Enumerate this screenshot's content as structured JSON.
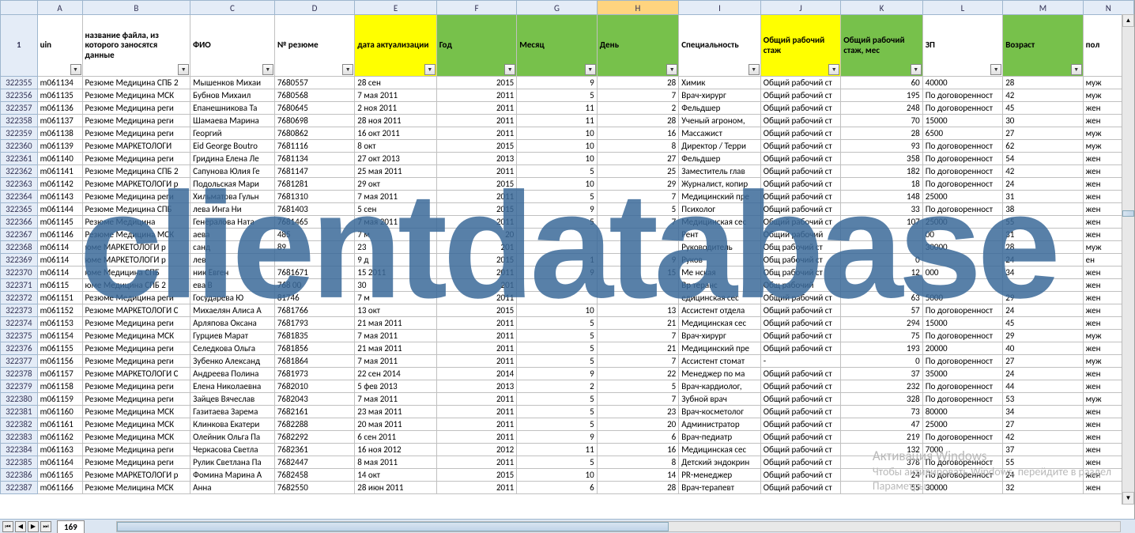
{
  "watermark": "clientdatabase",
  "activation": {
    "line1": "Активация Windows",
    "line2": "Чтобы активировать Windows, перейдите в раздел",
    "line3": "Параметры."
  },
  "sheet_tab": "169",
  "columns": [
    "",
    "A",
    "B",
    "C",
    "D",
    "E",
    "F",
    "G",
    "H",
    "I",
    "J",
    "K",
    "L",
    "M",
    "N"
  ],
  "selected_col": "H",
  "header_row_num": "1",
  "headers": {
    "A": {
      "label": "uin",
      "style": ""
    },
    "B": {
      "label": "название файла, из которого заносятся данные",
      "style": ""
    },
    "C": {
      "label": "ФИО",
      "style": ""
    },
    "D": {
      "label": "№ резюме",
      "style": ""
    },
    "E": {
      "label": "дата актуализации",
      "style": "hyellow"
    },
    "F": {
      "label": "Год",
      "style": "hgreen"
    },
    "G": {
      "label": "Месяц",
      "style": "hgreen"
    },
    "H": {
      "label": "День",
      "style": "hgreen"
    },
    "I": {
      "label": "Специальность",
      "style": ""
    },
    "J": {
      "label": "Общий рабочий стаж",
      "style": "hyellow"
    },
    "K": {
      "label": "Общий рабочий стаж, мес",
      "style": "hgreen"
    },
    "L": {
      "label": "ЗП",
      "style": ""
    },
    "M": {
      "label": "Возраст",
      "style": "hgreen"
    },
    "N": {
      "label": "пол",
      "style": ""
    }
  },
  "rows": [
    {
      "n": "322355",
      "A": "m061134",
      "B": "Резюме Медицина СПБ 2",
      "C": "Мышенков Михаи",
      "D": "7680557",
      "E": "28 сен",
      "F": "2015",
      "G": "9",
      "H": "28",
      "I": "Химик",
      "J": "Общий рабочий ст",
      "K": "60",
      "L": "40000",
      "M": "28",
      "N": "муж"
    },
    {
      "n": "322356",
      "A": "m061135",
      "B": "Резюме Медицина МСК",
      "C": "Бубнов Михаил",
      "D": "7680568",
      "E": "7 мая 2011",
      "F": "2011",
      "G": "5",
      "H": "7",
      "I": "Врач-хирург",
      "J": "Общий рабочий ст",
      "K": "195",
      "L": "По договоренност",
      "M": "42",
      "N": "муж"
    },
    {
      "n": "322357",
      "A": "m061136",
      "B": "Резюме Медицина реги",
      "C": "Епанешникова Та",
      "D": "7680645",
      "E": "2 ноя 2011",
      "F": "2011",
      "G": "11",
      "H": "2",
      "I": "Фельдшер",
      "J": "Общий рабочий ст",
      "K": "248",
      "L": "По договоренност",
      "M": "45",
      "N": "жен"
    },
    {
      "n": "322358",
      "A": "m061137",
      "B": "Резюме Медицина реги",
      "C": "Шамаева Марина",
      "D": "7680698",
      "E": "28 ноя 2011",
      "F": "2011",
      "G": "11",
      "H": "28",
      "I": "Ученый агроном,",
      "J": "Общий рабочий ст",
      "K": "70",
      "L": "15000",
      "M": "30",
      "N": "жен"
    },
    {
      "n": "322359",
      "A": "m061138",
      "B": "Резюме Медицина реги",
      "C": "Георгий",
      "D": "7680862",
      "E": "16 окт 2011",
      "F": "2011",
      "G": "10",
      "H": "16",
      "I": "Массажист",
      "J": "Общий рабочий ст",
      "K": "28",
      "L": "6500",
      "M": "27",
      "N": "муж"
    },
    {
      "n": "322360",
      "A": "m061139",
      "B": "Резюме МАРКЕТОЛОГИ",
      "C": "Eid George Boutro",
      "D": "7681116",
      "E": "8 окт",
      "F": "2015",
      "G": "10",
      "H": "8",
      "I": "Директор / Терри",
      "J": "Общий рабочий ст",
      "K": "93",
      "L": "По договоренност",
      "M": "62",
      "N": "муж"
    },
    {
      "n": "322361",
      "A": "m061140",
      "B": "Резюме Медицина реги",
      "C": "Гридина Елена Ле",
      "D": "7681134",
      "E": "27 окт 2013",
      "F": "2013",
      "G": "10",
      "H": "27",
      "I": "Фельдшер",
      "J": "Общий рабочий ст",
      "K": "358",
      "L": "По договоренност",
      "M": "54",
      "N": "жен"
    },
    {
      "n": "322362",
      "A": "m061141",
      "B": "Резюме Медицина СПБ 2",
      "C": "Сапунова Юлия Ге",
      "D": "7681147",
      "E": "25 мая 2011",
      "F": "2011",
      "G": "5",
      "H": "25",
      "I": "Заместитель глав",
      "J": "Общий рабочий ст",
      "K": "182",
      "L": "По договоренност",
      "M": "42",
      "N": "жен"
    },
    {
      "n": "322363",
      "A": "m061142",
      "B": "Резюме МАРКЕТОЛОГИ р",
      "C": "Подольская Мари",
      "D": "7681281",
      "E": "29 окт",
      "F": "2015",
      "G": "10",
      "H": "29",
      "I": "Журналист, копир",
      "J": "Общий рабочий ст",
      "K": "18",
      "L": "По договоренност",
      "M": "24",
      "N": "жен"
    },
    {
      "n": "322364",
      "A": "m061143",
      "B": "Резюме Медицина реги",
      "C": "Хильматова Гульн",
      "D": "7681310",
      "E": "7 мая 2011",
      "F": "2011",
      "G": "5",
      "H": "7",
      "I": "Медицинский пре",
      "J": "Общий рабочий ст",
      "K": "148",
      "L": "25000",
      "M": "31",
      "N": "жен"
    },
    {
      "n": "322365",
      "A": "m061144",
      "B": "Резюме Медицина СПБ",
      "C": "лева Инга Ни",
      "D": "7681403",
      "E": "5 сен",
      "F": "2015",
      "G": "9",
      "H": "5",
      "I": "Психолог",
      "J": "Общий рабочий ст",
      "K": "33",
      "L": "По договоренност",
      "M": "38",
      "N": "жен"
    },
    {
      "n": "322366",
      "A": "m061145",
      "B": "Резюме Медицина",
      "C": "Генералова Ната",
      "D": "7681465",
      "E": "7 мая 2011",
      "F": "2011",
      "G": "5",
      "H": "7",
      "I": "Медицинская сес",
      "J": "Общий рабочий ст",
      "K": "107",
      "L": "25000",
      "M": "55",
      "N": "жен"
    },
    {
      "n": "322367",
      "A": "m061146",
      "B": "Резюме Медицина МСК",
      "C": "аева",
      "D": "485",
      "E": "7 м",
      "F": "20",
      "G": "",
      "H": "",
      "I": "Рент",
      "J": "Общий рабочий",
      "K": "",
      "L": "00",
      "M": "31",
      "N": "жен"
    },
    {
      "n": "322368",
      "A": "m06114",
      "B": "юме МАРКЕТОЛОГИ р",
      "C": "санд",
      "D": "89",
      "E": "23",
      "F": "201",
      "G": "",
      "H": "",
      "I": "Руководитель",
      "J": "Общ рабочий ст",
      "K": "",
      "L": "30000",
      "M": "28",
      "N": "муж"
    },
    {
      "n": "322369",
      "A": "m06114",
      "B": "юме МАРКЕТОЛОГИ р",
      "C": "лев",
      "D": "",
      "E": "9 д",
      "F": "2015",
      "G": "1",
      "H": "9",
      "I": "Руков",
      "J": "Общ рабочий ст",
      "K": "0",
      "L": "",
      "M": "24",
      "N": "ен"
    },
    {
      "n": "322370",
      "A": "m06114",
      "B": "юме Медицина СПБ",
      "C": "ник Евген",
      "D": "7681671",
      "E": "15    2011",
      "F": "2011",
      "G": "9",
      "H": "15",
      "I": "Ме     нская",
      "J": "Общ рабочий ст",
      "K": "12",
      "L": "000",
      "M": "34",
      "N": "жен"
    },
    {
      "n": "322371",
      "A": "m06115",
      "B": "юме Медицина СПБ 2",
      "C": "ева В",
      "D": "768    00",
      "E": "30",
      "F": "201",
      "G": "",
      "H": "",
      "I": "Вр  теранс",
      "J": "Общ   рабочий",
      "K": "",
      "L": "",
      "M": "",
      "N": "жен"
    },
    {
      "n": "322372",
      "A": "m061151",
      "B": "Резюме Медицина реги",
      "C": "Государева Ю",
      "D": "81746",
      "E": "7 м",
      "F": "2011",
      "G": "",
      "H": "",
      "I": "едицинская сес",
      "J": "Общий рабочий ст",
      "K": "63",
      "L": "5000",
      "M": "29",
      "N": "жен"
    },
    {
      "n": "322373",
      "A": "m061152",
      "B": "Резюме МАРКЕТОЛОГИ С",
      "C": "Михаелян Алиса А",
      "D": "7681766",
      "E": "13 окт",
      "F": "2015",
      "G": "10",
      "H": "13",
      "I": "Ассистент отдела",
      "J": "Общий рабочий ст",
      "K": "57",
      "L": "По договоренност",
      "M": "24",
      "N": "жен"
    },
    {
      "n": "322374",
      "A": "m061153",
      "B": "Резюме Медицина реги",
      "C": "Арляпова Оксана",
      "D": "7681793",
      "E": "21 мая 2011",
      "F": "2011",
      "G": "5",
      "H": "21",
      "I": "Медицинская сес",
      "J": "Общий рабочий ст",
      "K": "294",
      "L": "15000",
      "M": "45",
      "N": "жен"
    },
    {
      "n": "322375",
      "A": "m061154",
      "B": "Резюме Медицина МСК",
      "C": "Гурциев Марат",
      "D": "7681835",
      "E": "7 мая 2011",
      "F": "2011",
      "G": "5",
      "H": "7",
      "I": "Врач-хирург",
      "J": "Общий рабочий ст",
      "K": "75",
      "L": "По договоренност",
      "M": "29",
      "N": "муж"
    },
    {
      "n": "322376",
      "A": "m061155",
      "B": "Резюме Медицина реги",
      "C": "Селедкова Ольга",
      "D": "7681856",
      "E": "21 мая 2011",
      "F": "2011",
      "G": "5",
      "H": "21",
      "I": "Медицинский пре",
      "J": "Общий рабочий ст",
      "K": "193",
      "L": "20000",
      "M": "40",
      "N": "жен"
    },
    {
      "n": "322377",
      "A": "m061156",
      "B": "Резюме Медицина реги",
      "C": "Зубенко Александ",
      "D": "7681864",
      "E": "7 мая 2011",
      "F": "2011",
      "G": "5",
      "H": "7",
      "I": "Ассистент стомат",
      "J": "-",
      "K": "0",
      "L": "По договоренност",
      "M": "27",
      "N": "муж"
    },
    {
      "n": "322378",
      "A": "m061157",
      "B": "Резюме МАРКЕТОЛОГИ С",
      "C": "Андреева Полина",
      "D": "7681973",
      "E": "22 сен 2014",
      "F": "2014",
      "G": "9",
      "H": "22",
      "I": "Менеджер по ма",
      "J": "Общий рабочий ст",
      "K": "37",
      "L": "35000",
      "M": "24",
      "N": "жен"
    },
    {
      "n": "322379",
      "A": "m061158",
      "B": "Резюме Медицина реги",
      "C": "Елена Николаевна",
      "D": "7682010",
      "E": "5 фев 2013",
      "F": "2013",
      "G": "2",
      "H": "5",
      "I": "Врач-кардиолог,",
      "J": "Общий рабочий ст",
      "K": "232",
      "L": "По договоренност",
      "M": "44",
      "N": "жен"
    },
    {
      "n": "322380",
      "A": "m061159",
      "B": "Резюме Медицина реги",
      "C": "Зайцев Вячеслав",
      "D": "7682043",
      "E": "7 мая 2011",
      "F": "2011",
      "G": "5",
      "H": "7",
      "I": "Зубной врач",
      "J": "Общий рабочий ст",
      "K": "328",
      "L": "По договоренност",
      "M": "53",
      "N": "муж"
    },
    {
      "n": "322381",
      "A": "m061160",
      "B": "Резюме Медицина МСК",
      "C": "Газитаева Зарема",
      "D": "7682161",
      "E": "23 мая 2011",
      "F": "2011",
      "G": "5",
      "H": "23",
      "I": "Врач-косметолог",
      "J": "Общий рабочий ст",
      "K": "73",
      "L": "80000",
      "M": "34",
      "N": "жен"
    },
    {
      "n": "322382",
      "A": "m061161",
      "B": "Резюме Медицина МСК",
      "C": "Клинкова Екатери",
      "D": "7682288",
      "E": "20 мая 2011",
      "F": "2011",
      "G": "5",
      "H": "20",
      "I": "Администратор",
      "J": "Общий рабочий ст",
      "K": "47",
      "L": "25000",
      "M": "27",
      "N": "жен"
    },
    {
      "n": "322383",
      "A": "m061162",
      "B": "Резюме Медицина МСК",
      "C": "Олейник Ольга Па",
      "D": "7682292",
      "E": "6 сен 2011",
      "F": "2011",
      "G": "9",
      "H": "6",
      "I": "Врач-педиатр",
      "J": "Общий рабочий ст",
      "K": "219",
      "L": "По договоренност",
      "M": "42",
      "N": "жен"
    },
    {
      "n": "322384",
      "A": "m061163",
      "B": "Резюме Медицина реги",
      "C": "Черкасова Светла",
      "D": "7682361",
      "E": "16 ноя 2012",
      "F": "2012",
      "G": "11",
      "H": "16",
      "I": "Медицинская сес",
      "J": "Общий рабочий ст",
      "K": "132",
      "L": "7000",
      "M": "37",
      "N": "жен"
    },
    {
      "n": "322385",
      "A": "m061164",
      "B": "Резюме Медицина реги",
      "C": "Рулик Светлана Па",
      "D": "7682447",
      "E": "8 мая 2011",
      "F": "2011",
      "G": "5",
      "H": "8",
      "I": "Детский эндокрин",
      "J": "Общий рабочий ст",
      "K": "378",
      "L": "По договоренност",
      "M": "55",
      "N": "жен"
    },
    {
      "n": "322386",
      "A": "m061165",
      "B": "Резюме МАРКЕТОЛОГИ р",
      "C": "Фомина Марина А",
      "D": "7682458",
      "E": "14 окт",
      "F": "2015",
      "G": "10",
      "H": "14",
      "I": "PR-менеджер",
      "J": "Общий рабочий ст",
      "K": "24",
      "L": "По договоренност",
      "M": "24",
      "N": "жен"
    },
    {
      "n": "322387",
      "A": "m061166",
      "B": "Резюме Мелицина МСК",
      "C": "Анна",
      "D": "7682550",
      "E": "28 июн 2011",
      "F": "2011",
      "G": "6",
      "H": "28",
      "I": "Врач-терапевт",
      "J": "Общий рабочий ст",
      "K": "55",
      "L": "30000",
      "M": "32",
      "N": "жен"
    }
  ]
}
